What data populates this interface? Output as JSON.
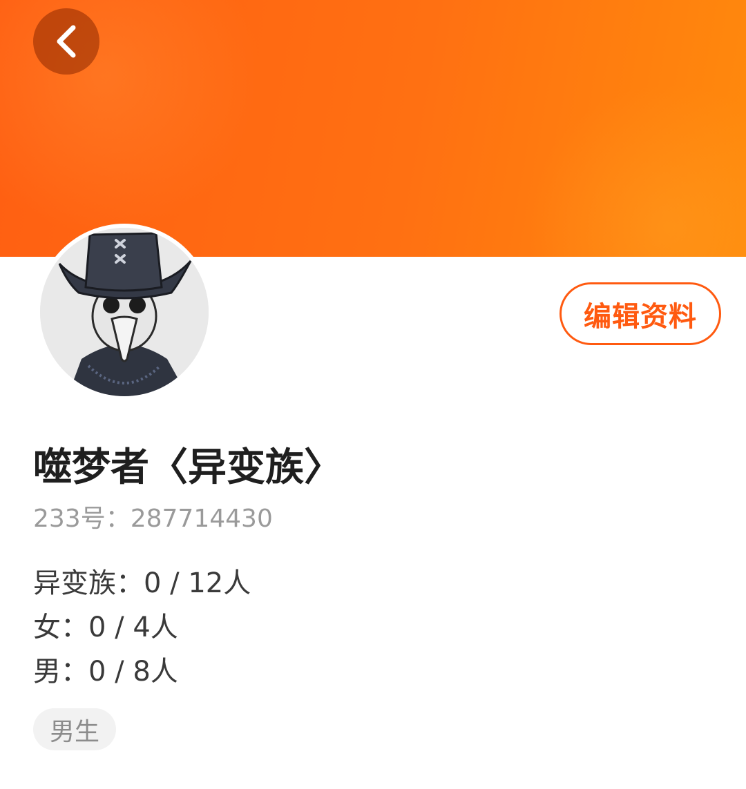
{
  "header": {
    "back_icon": "chevron-left-icon",
    "banner_colors": [
      "#ff5f12",
      "#ff8a0c"
    ]
  },
  "profile": {
    "nickname": "噬梦者〈异变族〉",
    "id_label": "233号：",
    "id_value": "287714430",
    "edit_button": "编辑资料"
  },
  "stats": [
    {
      "label": "异变族：",
      "value": "0 / 12人"
    },
    {
      "label": "女：",
      "value": "0 / 4人"
    },
    {
      "label": "男：",
      "value": "0 / 8人"
    }
  ],
  "tags": [
    "男生"
  ],
  "colors": {
    "accent": "#ff5a10",
    "title_text": "#1f1f1f",
    "secondary_text": "#9a9a9a",
    "tag_bg": "#f2f2f2"
  }
}
